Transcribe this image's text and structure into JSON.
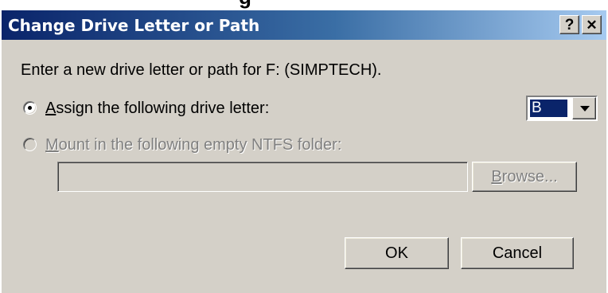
{
  "window": {
    "title": "Change Drive Letter or Path",
    "help_label": "?",
    "close_label": "✕"
  },
  "dialog": {
    "prompt": "Enter a new drive letter or path for F: (SIMPTECH).",
    "assign_option": {
      "accel": "A",
      "label_rest": "ssign the following drive letter:",
      "selected": true
    },
    "drive_letter": {
      "value": "B"
    },
    "mount_option": {
      "accel": "M",
      "label_rest": "ount in the following empty NTFS folder:",
      "selected": false,
      "enabled": false
    },
    "folder_path": {
      "value": ""
    },
    "browse_button": {
      "accel": "B",
      "label_rest": "rowse..."
    },
    "ok_label": "OK",
    "cancel_label": "Cancel"
  },
  "colors": {
    "title_gradient_start": "#0a246a",
    "title_gradient_end": "#a6caf0",
    "face": "#d4d0c8",
    "selection": "#0a246a"
  }
}
